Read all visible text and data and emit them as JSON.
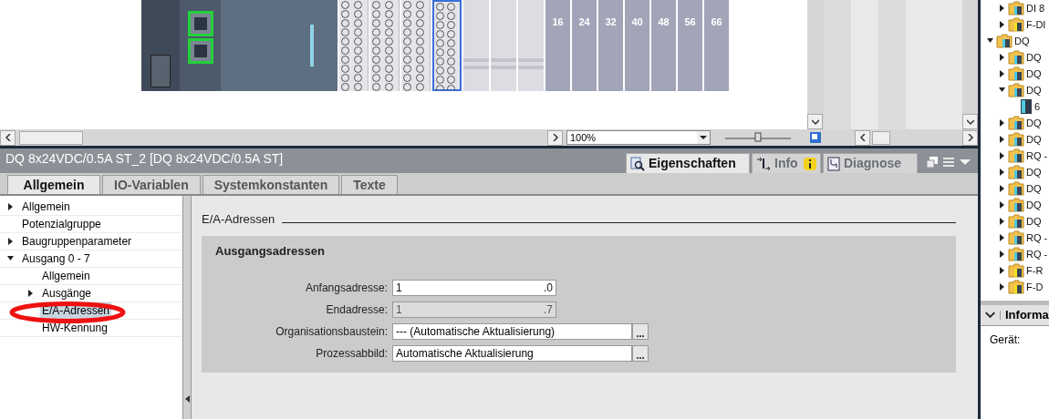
{
  "canvas": {
    "slot_labels": [
      "16",
      "24",
      "32",
      "40",
      "48",
      "56",
      "66"
    ],
    "zoom": "100%",
    "zoom_level": {
      "level": 0.5
    }
  },
  "inspector": {
    "title": "DQ 8x24VDC/0.5A ST_2 [DQ 8x24VDC/0.5A ST]",
    "view_tabs": [
      {
        "label": "Eigenschaften",
        "selected": true,
        "kind": "properties"
      },
      {
        "label": "Info",
        "selected": false,
        "kind": "info"
      },
      {
        "label": "Diagnose",
        "selected": false,
        "kind": "diagnose"
      }
    ],
    "tabs": [
      {
        "label": "Allgemein",
        "selected": true
      },
      {
        "label": "IO-Variablen",
        "selected": false
      },
      {
        "label": "Systemkonstanten",
        "selected": false
      },
      {
        "label": "Texte",
        "selected": false
      }
    ],
    "nav": [
      {
        "label": "Allgemein",
        "expanded": false,
        "selected": false
      },
      {
        "label": "Potenzialgruppe",
        "selected": false
      },
      {
        "label": "Baugruppenparameter",
        "expanded": false,
        "selected": false
      },
      {
        "label": "Ausgang 0 - 7",
        "expanded": true,
        "selected": false,
        "children": [
          {
            "label": "Allgemein",
            "selected": false
          },
          {
            "label": "Ausgänge",
            "expanded": false,
            "selected": false
          },
          {
            "label": "E/A-Adressen",
            "selected": true
          },
          {
            "label": "HW-Kennung",
            "selected": false
          }
        ]
      }
    ],
    "section_title": "E/A-Adressen",
    "group_title": "Ausgangsadressen",
    "fields": [
      {
        "label": "Anfangsadresse:",
        "value": "1",
        "suffix": ".0",
        "kind": "address",
        "disabled": false
      },
      {
        "label": "Endadresse:",
        "value": "1",
        "suffix": ".7",
        "kind": "address",
        "disabled": true
      },
      {
        "label": "Organisationsbaustein:",
        "value": "--- (Automatische Aktualisierung)",
        "button": "...",
        "kind": "picker",
        "disabled": false
      },
      {
        "label": "Prozessabbild:",
        "value": "Automatische Aktualisierung",
        "button": "...",
        "kind": "picker",
        "disabled": false
      }
    ]
  },
  "catalog": {
    "items_above": [
      {
        "label": "DI 8",
        "expanded": false,
        "kind": "folder"
      },
      {
        "label": "F-DI",
        "expanded": false,
        "kind": "folder-yellow"
      }
    ],
    "items": [
      {
        "label": "DQ",
        "expanded": true,
        "kind": "folder",
        "children": [
          {
            "label": "DQ",
            "expanded": false,
            "kind": "folder"
          },
          {
            "label": "DQ",
            "expanded": false,
            "kind": "folder"
          },
          {
            "label": "DQ",
            "expanded": true,
            "kind": "folder",
            "children": [
              {
                "label": "6",
                "kind": "module"
              }
            ]
          },
          {
            "label": "DQ",
            "expanded": false,
            "kind": "folder"
          },
          {
            "label": "DQ",
            "expanded": false,
            "kind": "folder"
          },
          {
            "label": "RQ -",
            "expanded": false,
            "kind": "folder"
          },
          {
            "label": "DQ",
            "expanded": false,
            "kind": "folder"
          },
          {
            "label": "DQ",
            "expanded": false,
            "kind": "folder"
          },
          {
            "label": "DQ",
            "expanded": false,
            "kind": "folder"
          },
          {
            "label": "DQ",
            "expanded": false,
            "kind": "folder"
          },
          {
            "label": "RQ -",
            "expanded": false,
            "kind": "folder"
          },
          {
            "label": "RQ -",
            "expanded": false,
            "kind": "folder"
          },
          {
            "label": "F-R",
            "expanded": false,
            "kind": "folder-yellow"
          },
          {
            "label": "F-D",
            "expanded": false,
            "kind": "folder-yellow"
          }
        ]
      }
    ],
    "info_header": "Informa",
    "info_label": "Gerät:"
  }
}
